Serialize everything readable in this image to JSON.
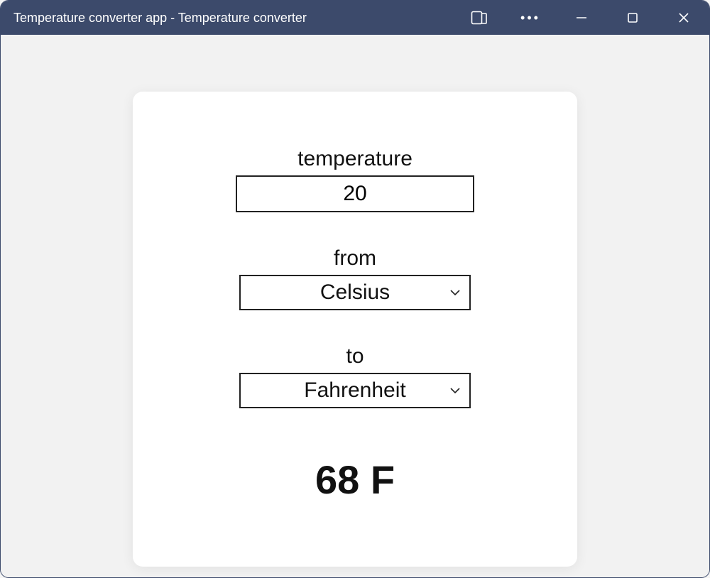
{
  "window": {
    "title": "Temperature converter app - Temperature converter"
  },
  "form": {
    "temperature": {
      "label": "temperature",
      "value": "20"
    },
    "from": {
      "label": "from",
      "selected": "Celsius"
    },
    "to": {
      "label": "to",
      "selected": "Fahrenheit"
    }
  },
  "result": {
    "text": "68 F"
  }
}
